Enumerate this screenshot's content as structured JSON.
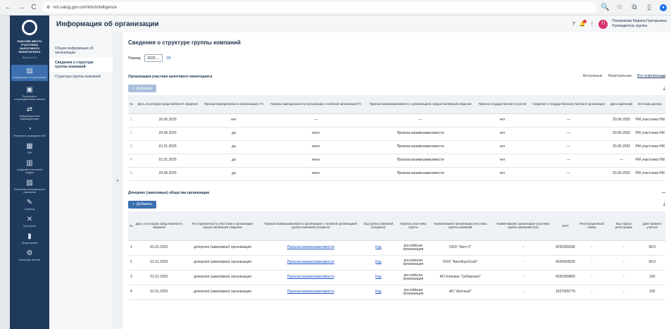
{
  "browser": {
    "url": "nm.nalog.gov.ru/#/info/intelligence",
    "back": "←",
    "forward": "→",
    "reload": "C"
  },
  "rail": {
    "title": "РАБОЧЕЕ МЕСТО УЧАСТНИКА НАЛОГОВОГО МОНИТОРИНГА",
    "version": "Версия 2.0.8",
    "items": [
      {
        "label": "Информация об организации",
        "icon": "document-icon"
      },
      {
        "label": "Поручения и сопроводительные письма",
        "icon": "folder-icon"
      },
      {
        "label": "Информационное взаимодействие",
        "icon": "exchange-icon"
      },
      {
        "label": "Результаты проведения НМ",
        "icon": "chart-icon"
      },
      {
        "label": "СВК",
        "icon": "building-icon"
      },
      {
        "label": "Цифровой налоговый модуль",
        "icon": "module-icon"
      },
      {
        "label": "Финансово-экономические показатели",
        "icon": "finance-icon"
      },
      {
        "label": "Сервисы",
        "icon": "tools-icon"
      },
      {
        "label": "Протоколы",
        "icon": "protocol-icon"
      },
      {
        "label": "Предложения",
        "icon": "bar-icon"
      },
      {
        "label": "Настройки агентов",
        "icon": "settings-icon"
      }
    ]
  },
  "topbar": {
    "title": "Информация об организации",
    "user_name": "Полевикова Марина Григорьевна",
    "user_role": "Руководитель группы",
    "user_initial": "П",
    "notif_count": "1"
  },
  "submenu": {
    "items": [
      "Общая информация об организации",
      "Сведения о структуре группы компаний",
      "Структура группы компаний"
    ],
    "active_index": 1
  },
  "page": {
    "heading": "Сведения о структуре группы компаний",
    "period_label": "Период",
    "period_value": "2025",
    "views": [
      "Актуальные",
      "Неактуальные",
      "Все информация"
    ]
  },
  "section1": {
    "title": "Организация-участник налогового мониторинга",
    "add_label": "Добавить",
    "headers": [
      "№",
      "Дата, на которую представляются сведения",
      "Признак принадлежности организации к ГК",
      "Признак принадлежности организации к головной организации ГК",
      "Признак взаимозависимости с организацией, предоставляющей сведения",
      "Признак государственного участия",
      "Сведения о государственном участии в организации",
      "Дата изменения",
      "Источник данных"
    ],
    "rows": [
      [
        "1",
        "20.06.2025",
        "нет",
        "—",
        "—",
        "нет",
        "—",
        "20.06.2025",
        "РМ участника НМ"
      ],
      [
        "2",
        "20.06.2025",
        "да",
        "иное",
        "Признак взаимозависимости",
        "нет",
        "—",
        "20.06.2025",
        "РМ участника НМ"
      ],
      [
        "3",
        "01.01.2025",
        "да",
        "иное",
        "Признак взаимозависимости",
        "нет",
        "—",
        "20.06.2025",
        "РМ участника НМ"
      ],
      [
        "4",
        "01.01.2025",
        "да",
        "иное",
        "Признак взаимозависимости",
        "нет",
        "—",
        "—",
        "РМ участника НМ"
      ],
      [
        "5",
        "20.06.2025",
        "да",
        "иное",
        "Признак взаимозависимости",
        "нет",
        "—",
        "20.06.2025",
        "РМ участника НМ"
      ]
    ]
  },
  "section2": {
    "title": "Дочерние (зависимые) общества организации",
    "add_label": "Добавить",
    "headers": [
      "№",
      "Дата, на которую представляются сведения",
      "Тип подчиненности участника к организации, предоставляющей сведения",
      "Признак взаимозависимости организации с головной организацией группы компаний (холдинга)",
      "Код группы компаний (холдинга)",
      "Признак участника группы",
      "Наименование организации участника группы компаний",
      "Наименование организации участника группы компаний (лат)",
      "ИНН",
      "Регистрационный номер",
      "Код страны регистрации",
      "Доля прямого участия"
    ],
    "rows": [
      [
        "1",
        "01.01.2025",
        "дочерняя (зависимая) организация",
        "Признак взаимозависимости",
        "Код",
        "российская организация",
        "ООО \"Азот-2\"",
        "-",
        "4205356336",
        "-",
        "-",
        "99.9"
      ],
      [
        "2",
        "01.01.2025",
        "дочерняя (зависимая) организация",
        "Признак взаимозависимости",
        "Код",
        "российская организация",
        "ООО \"АзотАгроСнаб\"",
        "-",
        "4205403630",
        "-",
        "-",
        "99.9"
      ],
      [
        "3",
        "01.01.2025",
        "дочерняя (зависимая) организация",
        "Признак взаимозависимости",
        "Код",
        "российская организация",
        "АО Клиника \"Сибирская\"",
        "-",
        "4205356800",
        "-",
        "-",
        "100"
      ],
      [
        "4",
        "01.01.2025",
        "дочерняя (зависимая) организация",
        "Признак взаимозависимости",
        "Код",
        "российская организация",
        "АО \"Азотный\"",
        "-",
        "1627005779",
        "-",
        "-",
        "100"
      ]
    ]
  }
}
